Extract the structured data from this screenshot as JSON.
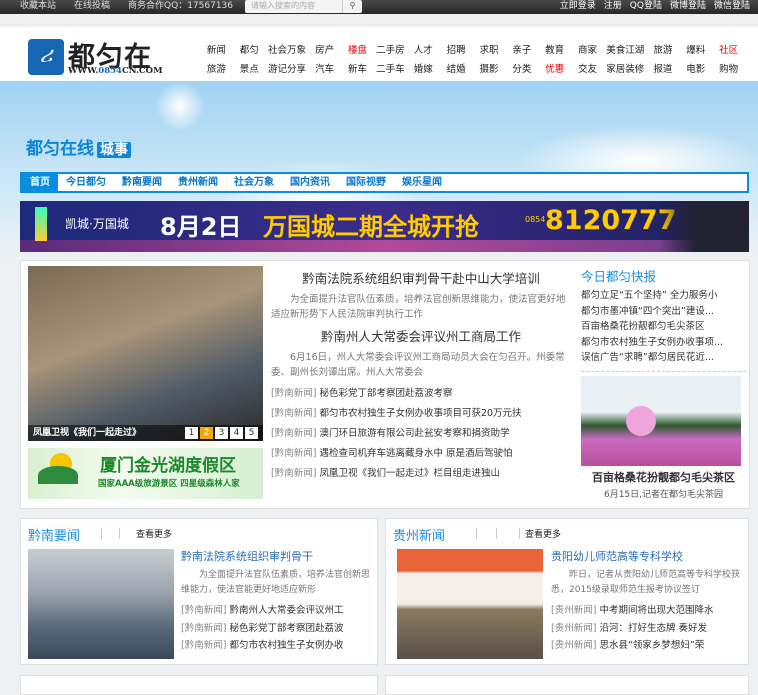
{
  "topbar": {
    "links": [
      "收藏本站",
      "在线投稿",
      "商务合作QQ：17567136"
    ],
    "search_placeholder": "请输入搜索的内容",
    "search_icon": "magnifier",
    "right": [
      "立即登录",
      "注册",
      "QQ登陆",
      "微博登陆",
      "微信登陆"
    ]
  },
  "logo": {
    "name": "都匀在线",
    "url": "WWW.0854CN.COM",
    "url_a": "WWW.",
    "url_b": "0854",
    "url_c": "CN.COM"
  },
  "nav": {
    "row1": [
      "新闻",
      "都匀",
      "社会万象",
      "房产",
      "楼盘",
      "二手房",
      "人才",
      "招聘",
      "求职",
      "亲子",
      "教育",
      "商家",
      "美食江湖",
      "旅游",
      "爆料",
      "社区"
    ],
    "row2": [
      "旅游",
      "景点",
      "游记分享",
      "汽车",
      "新车",
      "二手车",
      "婚嫁",
      "结婚",
      "摄影",
      "分类",
      "优惠",
      "交友",
      "家居装修",
      "报道",
      "电影",
      "购物"
    ],
    "red": [
      "楼盘",
      "社区",
      "优惠"
    ]
  },
  "brand": {
    "name": "都匀在线",
    "tag": "城事"
  },
  "mainnav": [
    "首页",
    "今日都匀",
    "黔南要闻",
    "贵州新闻",
    "社会万象",
    "国内资讯",
    "国际视野",
    "娱乐星闻"
  ],
  "ad1": {
    "brand": "凯城·万国城",
    "date": "8月2日",
    "msg": "万国城二期全城开抢",
    "area": "0854",
    "phone": "8120777"
  },
  "slideshow": {
    "caption": "凤凰卫视《我们一起走过》",
    "pages": [
      "1",
      "2",
      "3",
      "4",
      "5"
    ],
    "active": 2
  },
  "ad2": {
    "title": "厦门金光湖度假区",
    "sub": "国家AAA级旅游景区  四星级森林人家"
  },
  "headlines": [
    {
      "title": "黔南法院系统组织审判骨干赴中山大学培训",
      "summary": "为全面提升法官队伍素质，培养法官创新思维能力，使法官更好地适应新形势下人民法院审判执行工作"
    },
    {
      "title": "黔南州人大常委会评议州工商局工作",
      "summary": "6月16日，州人大常委会评议州工商局动员大会在匀召开。州委常委、副州长刘谭出席。州人大常委会"
    }
  ],
  "news_links": [
    {
      "tag": "[黔南新闻]",
      "text": "秘色彩党丁部考察团赴荔波考察"
    },
    {
      "tag": "[黔南新闻]",
      "text": "都匀市农村独生子女例办收事项目可获20万元扶"
    },
    {
      "tag": "[黔南新闻]",
      "text": "澳门环日旅游有限公司赴瓮安考察和捐资助学"
    },
    {
      "tag": "[黔南新闻]",
      "text": "遇检查司机弃车逃离藏身水中 原是酒后驾驶怕"
    },
    {
      "tag": "[黔南新闻]",
      "text": "凤凰卫视《我们一起走过》栏目组走进独山"
    }
  ],
  "kuaibao": {
    "title": "今日都匀快报",
    "items": [
      "都匀立足“五个坚持” 全力服务小",
      "都匀市墨冲镇“四个突出”建设...",
      "百亩格桑花扮靓都匀毛尖茶区",
      "都匀市农村独生子女例办收事项...",
      "误信广告“求聘”都匀居民花近..."
    ],
    "photo_title": "百亩格桑花扮靓都匀毛尖茶区",
    "photo_sub": "6月15日,记者在都匀毛尖茶园"
  },
  "sections": [
    {
      "title": "黔南要闻",
      "more": "查看更多",
      "headline": "黔南法院系统组织审判骨干",
      "summary": "为全面提升法官队伍素质，培养法官创新思维能力，使法官能更好地适应新形",
      "links": [
        {
          "tag": "[黔南新闻]",
          "text": "黔南州人大常委会评议州工"
        },
        {
          "tag": "[黔南新闻]",
          "text": "秘色彩党丁部考察团赴荔波"
        },
        {
          "tag": "[黔南新闻]",
          "text": "都匀市农村独生子女例办收"
        }
      ]
    },
    {
      "title": "贵州新闻",
      "more": "查看更多",
      "headline": "贵阳幼儿师范高等专科学校",
      "summary": "昨日，记者从贵阳幼儿师范高等专科学校获悉，2015级录取师范生报考协议签订",
      "links": [
        {
          "tag": "[贵州新闻]",
          "text": "中考期间将出现大范围降水"
        },
        {
          "tag": "[贵州新闻]",
          "text": "沿河：打好生态牌 奏好发"
        },
        {
          "tag": "[贵州新闻]",
          "text": "思水县“领家乡梦想妇”荣"
        }
      ]
    }
  ]
}
